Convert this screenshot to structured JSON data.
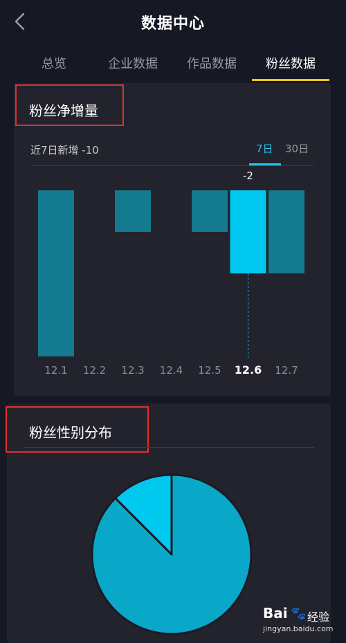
{
  "header": {
    "title": "数据中心"
  },
  "tabs": [
    {
      "label": "总览"
    },
    {
      "label": "企业数据"
    },
    {
      "label": "作品数据"
    },
    {
      "label": "粉丝数据"
    }
  ],
  "active_tab": 3,
  "net_gain_card": {
    "title": "粉丝净增量",
    "summary": "近7日新增 -10",
    "range_tabs": [
      "7日",
      "30日"
    ],
    "active_range": "7日"
  },
  "gender_card": {
    "title": "粉丝性别分布"
  },
  "watermark": {
    "logo": "Bai",
    "paw": "🐾",
    "jingyan": "经验",
    "url": "jingyan.baidu.com"
  },
  "colors": {
    "background": "#161823",
    "card": "#22232d",
    "accent_yellow": "#f5c518",
    "accent_cyan": "#2cc6e8",
    "bar_default": "#137a90",
    "bar_selected": "#00c8f0",
    "pie_main": "#0aa8c8",
    "pie_slice": "#00c8ee",
    "highlight_box": "#e0302e"
  },
  "chart_data": {
    "type": "bar",
    "categories": [
      "12.1",
      "12.2",
      "12.3",
      "12.4",
      "12.5",
      "12.6",
      "12.7"
    ],
    "values": [
      -4,
      0,
      -1,
      0,
      -1,
      -2,
      -2
    ],
    "selected_index": 5,
    "selected_label": "-2",
    "ylim": [
      -4,
      0
    ]
  },
  "pie_data": {
    "type": "pie",
    "slices": [
      {
        "value": 0.875
      },
      {
        "value": 0.125
      }
    ]
  }
}
